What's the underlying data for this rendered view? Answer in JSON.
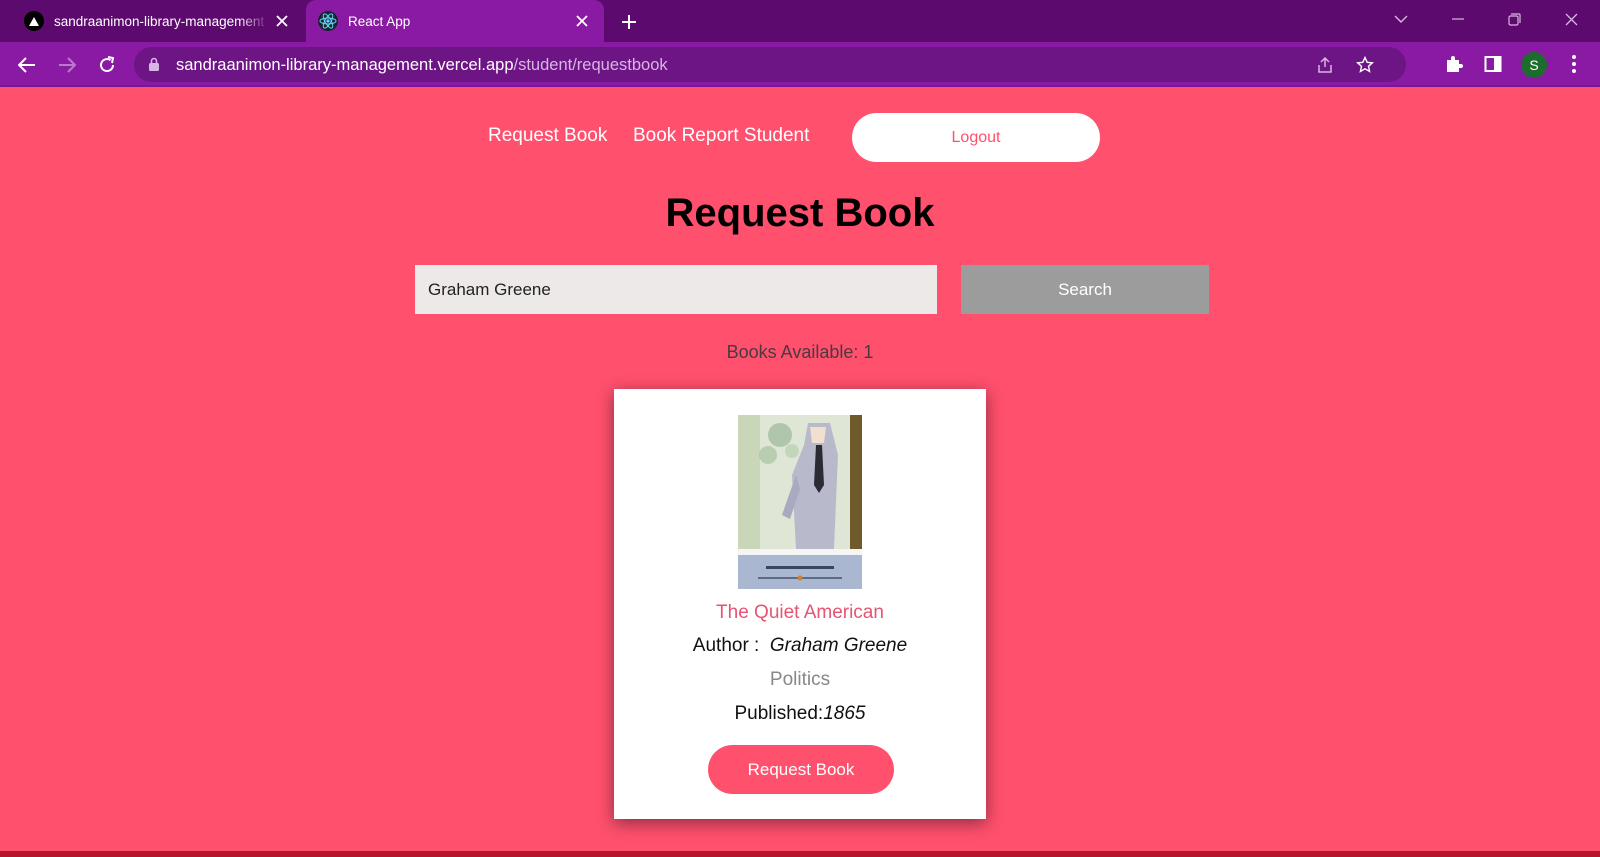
{
  "browser": {
    "tabs": [
      {
        "title": "sandraanimon-library-management",
        "icon": "vercel-triangle-icon",
        "active": false
      },
      {
        "title": "React App",
        "icon": "react-atom-icon",
        "active": true
      }
    ],
    "url_domain": "sandraanimon-library-management.vercel.app",
    "url_path": "/student/requestbook",
    "profile_initial": "S",
    "colors": {
      "tabstrip": "#5c0a6e",
      "toolbar": "#8a1aa3",
      "omnibox": "#6d1584",
      "avatar": "#1e6b2e"
    }
  },
  "nav": {
    "links": [
      "Request Book",
      "Book Report Student"
    ],
    "logout_label": "Logout"
  },
  "page": {
    "title": "Request Book",
    "search": {
      "value": "Graham Greene",
      "button_label": "Search"
    },
    "available_label": "Books Available: 1"
  },
  "book": {
    "title": "The Quiet American",
    "author_label": "Author :",
    "author": "Graham Greene",
    "genre": "Politics",
    "published_label": "Published:",
    "published_year": "1865",
    "request_label": "Request Book"
  },
  "colors": {
    "page_bg": "#ff506e",
    "accent": "#ff506e",
    "search_button": "#9c9c9c",
    "card_bg": "#ffffff"
  }
}
